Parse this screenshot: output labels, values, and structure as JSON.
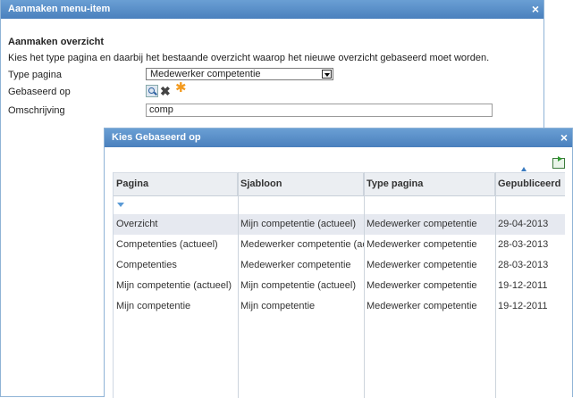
{
  "window1": {
    "title": "Aanmaken menu-item",
    "close": "×",
    "heading": "Aanmaken overzicht",
    "description": "Kies het type pagina en daarbij het bestaande overzicht waarop het nieuwe overzicht gebaseerd moet worden.",
    "fields": {
      "type_label": "Type pagina",
      "type_value": "Medewerker competentie",
      "based_label": "Gebaseerd op",
      "desc_label": "Omschrijving",
      "desc_value": "comp"
    }
  },
  "window2": {
    "title": "Kies Gebaseerd op",
    "close": "×",
    "columns": [
      "Pagina",
      "Sjabloon",
      "Type pagina",
      "Gepubliceerd"
    ],
    "rows": [
      [
        "Overzicht",
        "Mijn competentie (actueel)",
        "Medewerker competentie",
        "29-04-2013"
      ],
      [
        "Competenties (actueel)",
        "Medewerker competentie (actueel)",
        "Medewerker competentie",
        "28-03-2013"
      ],
      [
        "Competenties",
        "Medewerker competentie",
        "Medewerker competentie",
        "28-03-2013"
      ],
      [
        "Mijn competentie (actueel)",
        "Mijn competentie (actueel)",
        "Medewerker competentie",
        "19-12-2011"
      ],
      [
        "Mijn competentie",
        "Mijn competentie",
        "Medewerker competentie",
        "19-12-2011"
      ]
    ]
  },
  "icons": {
    "lookup": "magnifier-icon",
    "clear": "close-x-icon",
    "required": "asterisk-icon",
    "export": "export-icon"
  },
  "colors": {
    "titlebar": "#4a80bd",
    "selected_row": "#e6e9f0",
    "required_star": "#f39a1e"
  }
}
